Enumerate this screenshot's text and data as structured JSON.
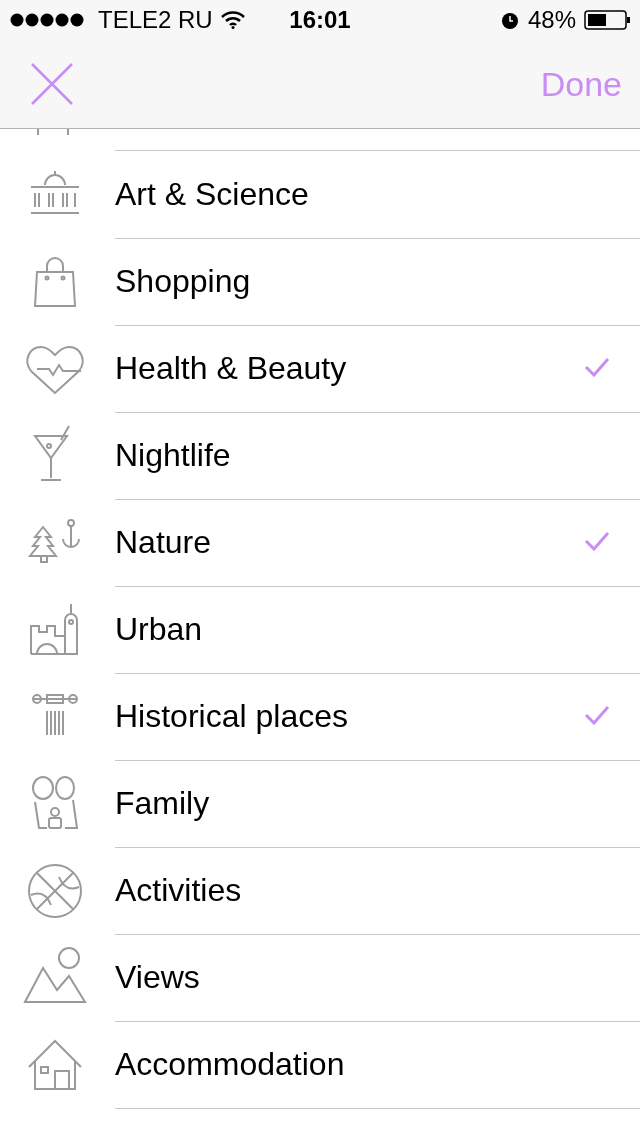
{
  "status_bar": {
    "carrier": "TELE2 RU",
    "time": "16:01",
    "battery": "48%"
  },
  "nav": {
    "done": "Done"
  },
  "categories": [
    {
      "label": "Art & Science",
      "checked": false
    },
    {
      "label": "Shopping",
      "checked": false
    },
    {
      "label": "Health & Beauty",
      "checked": true
    },
    {
      "label": "Nightlife",
      "checked": false
    },
    {
      "label": "Nature",
      "checked": true
    },
    {
      "label": "Urban",
      "checked": false
    },
    {
      "label": "Historical places",
      "checked": true
    },
    {
      "label": "Family",
      "checked": false
    },
    {
      "label": "Activities",
      "checked": false
    },
    {
      "label": "Views",
      "checked": false
    },
    {
      "label": "Accommodation",
      "checked": false
    }
  ]
}
